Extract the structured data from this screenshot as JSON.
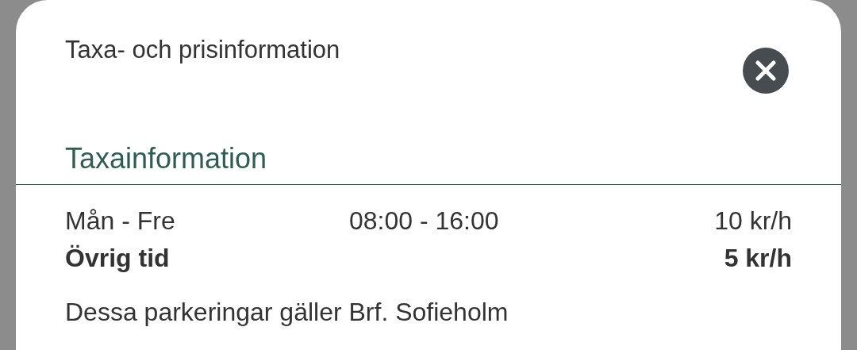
{
  "dialog": {
    "title": "Taxa- och prisinformation"
  },
  "section": {
    "heading": "Taxainformation"
  },
  "rates": [
    {
      "kind": "regular",
      "days": "Mån - Fre",
      "hours": "08:00 - 16:00",
      "price": "10 kr/h"
    },
    {
      "kind": "emphasis",
      "days": "Övrig tid",
      "price": "5 kr/h"
    }
  ],
  "note": "Dessa parkeringar gäller Brf. Sofieholm"
}
